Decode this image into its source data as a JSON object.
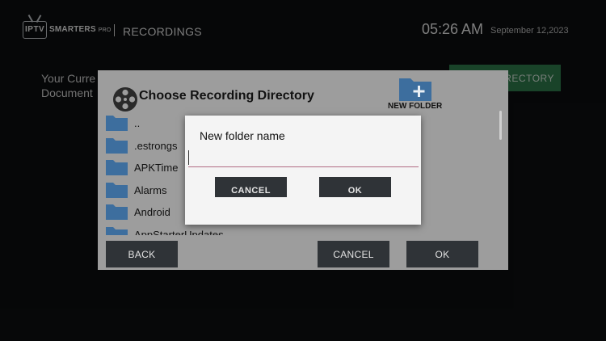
{
  "header": {
    "logo_iptv": "IPTV",
    "logo_brand": "SMARTERS",
    "logo_pro": "PRO",
    "page_title": "RECORDINGS",
    "time": "05:26 AM",
    "date": "September 12,2023"
  },
  "background": {
    "current_path_label": "Your Curre\nDocument",
    "choose_dir_button": "RECTORY"
  },
  "directory_dialog": {
    "title": "Choose Recording Directory",
    "new_folder_label": "NEW FOLDER",
    "folders": [
      {
        "name": ".."
      },
      {
        "name": ".estrongs"
      },
      {
        "name": "APKTime"
      },
      {
        "name": "Alarms"
      },
      {
        "name": "Android"
      },
      {
        "name": "AppStarterUpdates"
      }
    ],
    "back_label": "BACK",
    "cancel_label": "CANCEL",
    "ok_label": "OK"
  },
  "new_folder_dialog": {
    "title": "New folder name",
    "input_value": "",
    "cancel_label": "CANCEL",
    "ok_label": "OK"
  },
  "colors": {
    "background": "#0c0e10",
    "dialog_gray": "#9d9d9d",
    "folder_blue": "#3d6e9e",
    "button_dark": "#2f3337",
    "accent_green": "#2f7a4c",
    "input_underline": "#b06b83"
  }
}
